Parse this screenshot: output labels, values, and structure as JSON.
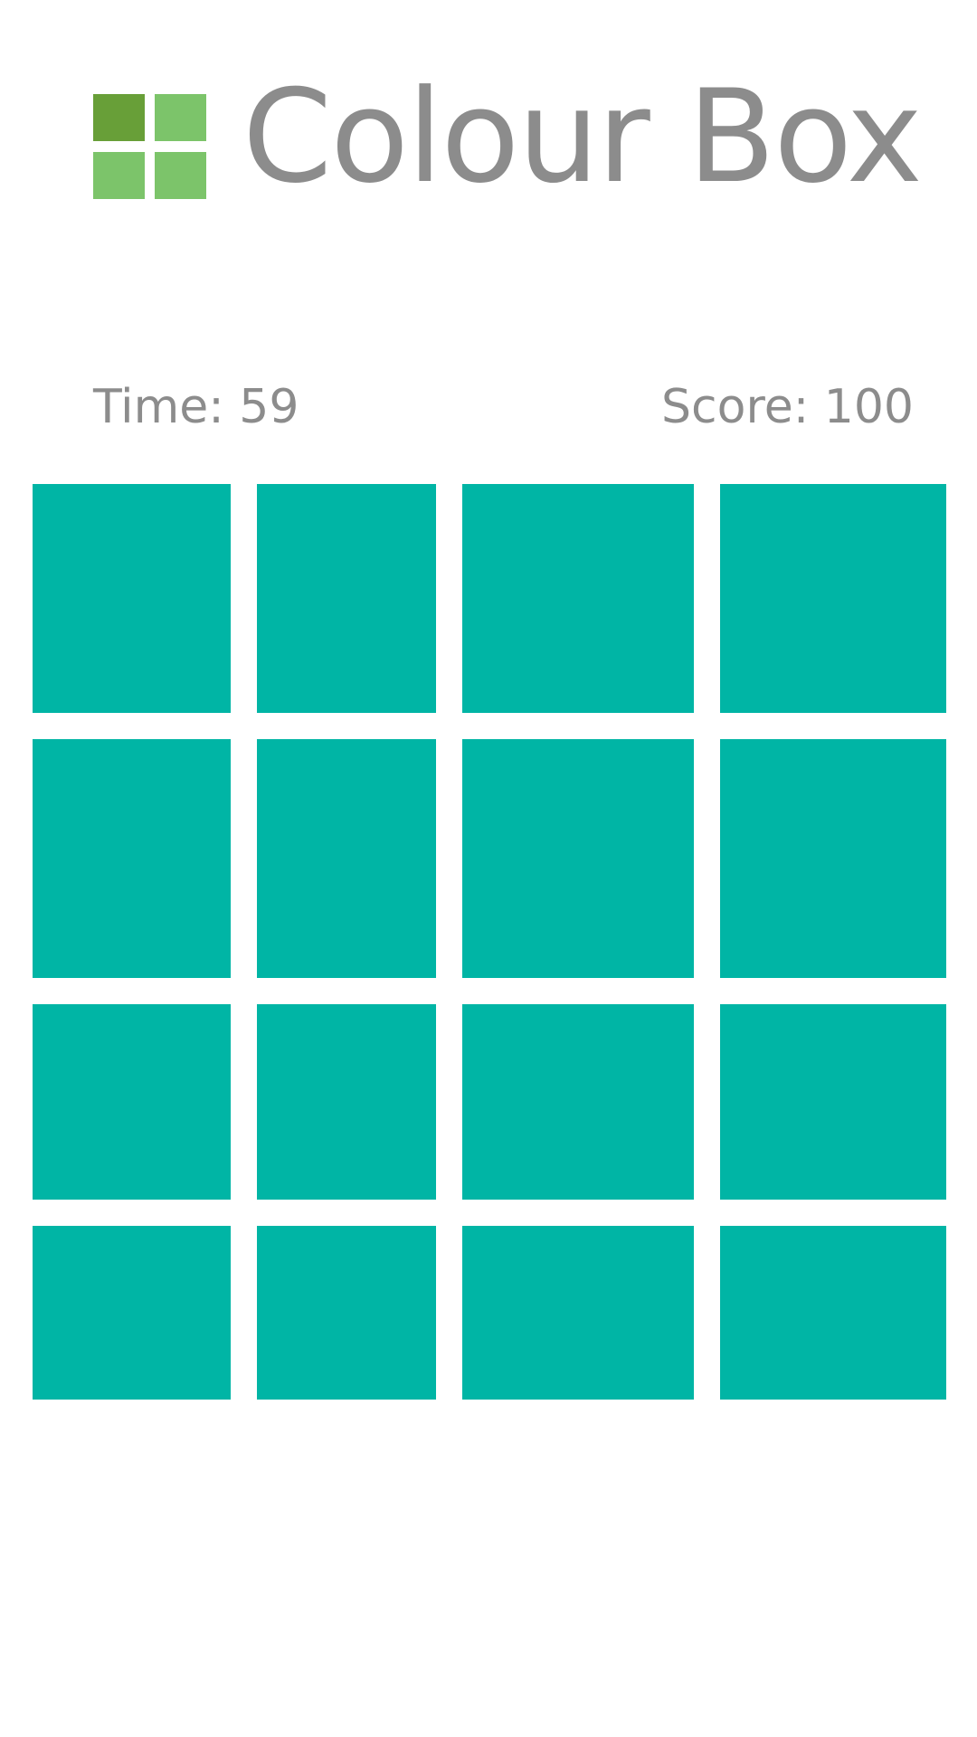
{
  "app": {
    "title": "Colour Box",
    "logo_colors": [
      "#689f38",
      "#7cc46a",
      "#7cc46a",
      "#7cc46a"
    ]
  },
  "status": {
    "time_text": "Time: 59",
    "score_text": "Score: 100"
  },
  "colors": {
    "tile": "#00b5a5",
    "text": "#8c8c8c",
    "background": "#ffffff"
  },
  "board": {
    "rows": 4,
    "columns": 4,
    "tiles": [
      "#00b5a5",
      "#00b5a5",
      "#00b5a5",
      "#00b5a5",
      "#00b5a5",
      "#00b5a5",
      "#00b5a5",
      "#00b5a5",
      "#00b5a5",
      "#00b5a5",
      "#00b5a5",
      "#00b5a5",
      "#00b5a5",
      "#00b5a5",
      "#00b5a5",
      "#00b5a5"
    ]
  }
}
